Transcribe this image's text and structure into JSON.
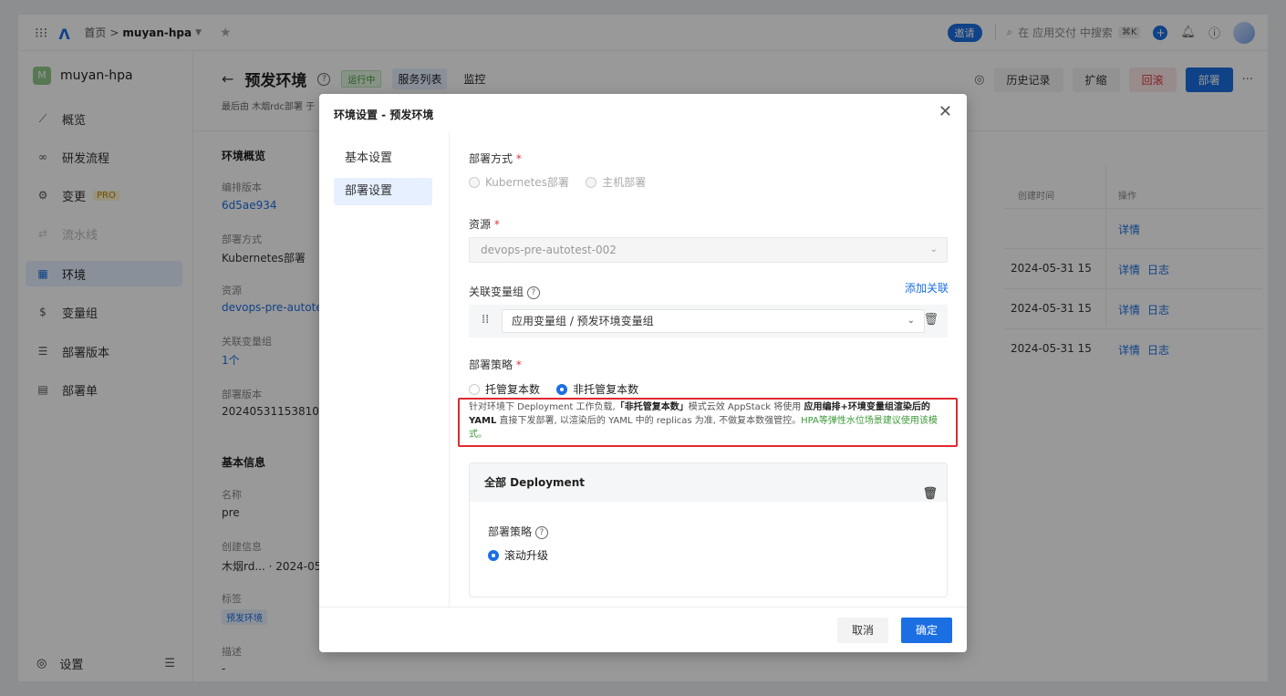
{
  "topbar": {
    "breadcrumb_home": "首页",
    "breadcrumb_sep": ">",
    "breadcrumb_app": "muyan-hpa",
    "invite_label": "邀请",
    "search_placeholder": "在 应用交付 中搜索",
    "search_shortcut": "⌘K"
  },
  "sidebar": {
    "app_initial": "M",
    "app_name": "muyan-hpa",
    "items": [
      {
        "label": "概览",
        "icon": "chart-icon"
      },
      {
        "label": "研发流程",
        "icon": "infinity-icon"
      },
      {
        "label": "变更",
        "icon": "change-icon",
        "badge": "PRO"
      },
      {
        "label": "流水线",
        "icon": "pipeline-icon"
      },
      {
        "label": "环境",
        "icon": "environment-icon"
      },
      {
        "label": "变量组",
        "icon": "variable-icon"
      },
      {
        "label": "部署版本",
        "icon": "version-icon"
      },
      {
        "label": "部署单",
        "icon": "order-icon"
      }
    ],
    "settings_label": "设置"
  },
  "header": {
    "title": "预发环境",
    "status": "运行中",
    "tabs": [
      "服务列表",
      "监控"
    ],
    "subtitle": "最后由 木烟rdc部署 于",
    "actions": {
      "history": "历史记录",
      "scale": "扩缩",
      "rollback": "回滚",
      "deploy": "部署"
    }
  },
  "overview": {
    "heading": "环境概览",
    "fields": [
      {
        "label": "编排版本",
        "value": "6d5ae934"
      },
      {
        "label": "部署方式",
        "value": "Kubernetes部署"
      },
      {
        "label": "资源",
        "value": "devops-pre-autote"
      },
      {
        "label": "关联变量组",
        "value": "1个"
      },
      {
        "label": "部署版本",
        "value": "20240531153810"
      }
    ],
    "basic_heading": "基本信息",
    "basic_fields": [
      {
        "label": "名称",
        "value": "pre"
      },
      {
        "label": "创建信息",
        "value": "木烟rd... · 2024-05"
      },
      {
        "label": "标签",
        "value": "预发环境"
      },
      {
        "label": "描述",
        "value": "-"
      }
    ]
  },
  "table": {
    "headers": [
      "创建时间",
      "操作"
    ],
    "rows": [
      {
        "time": "",
        "ops": [
          "详情"
        ]
      },
      {
        "time": "2024-05-31 15",
        "ops": [
          "详情",
          "日志"
        ]
      },
      {
        "time": "2024-05-31 15",
        "ops": [
          "详情",
          "日志"
        ]
      },
      {
        "time": "2024-05-31 15",
        "ops": [
          "详情",
          "日志"
        ]
      }
    ]
  },
  "modal": {
    "title": "环境设置 - 预发环境",
    "nav": [
      "基本设置",
      "部署设置"
    ],
    "deploy_mode_label": "部署方式",
    "deploy_mode_options": [
      "Kubernetes部署",
      "主机部署"
    ],
    "resource_label": "资源",
    "resource_value": "devops-pre-autotest-002",
    "var_group_label": "关联变量组",
    "add_link": "添加关联",
    "var_group_value": "应用变量组 / 预发环境变量组",
    "strategy_label": "部署策略",
    "strategy_options": [
      "托管复本数",
      "非托管复本数"
    ],
    "hint": {
      "p1": "针对环境下 Deployment 工作负载,",
      "b1": "「非托管复本数」",
      "p2": "模式云效 AppStack 将使用",
      "b2": "应用编排+环境变量组渲染后的 YAML",
      "p3": "直接下发部署, 以渲染后的 YAML 中的 replicas 为准, 不做复本数强管控。",
      "green": "HPA等弹性水位场景建议使用该模式。"
    },
    "deployment_card_title": "全部 Deployment",
    "deployment_strategy_label": "部署策略",
    "deployment_strategy_value": "滚动升级",
    "cancel": "取消",
    "ok": "确定"
  }
}
